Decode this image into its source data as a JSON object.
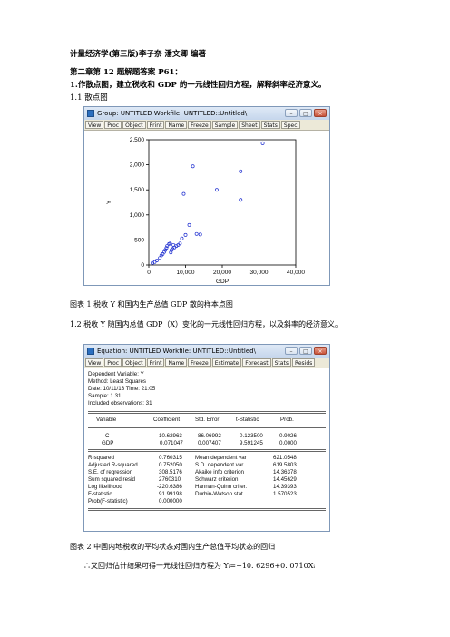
{
  "header": {
    "line1": "计量经济学(第三版)李子奈  潘文卿  编著",
    "line2": "第二章第 12 题解题答案 P61：",
    "line3": "1.作散点图，建立税收和 GDP 的一元线性回归方程，解释斜率经济意义。",
    "sec1": "1.1 散点图"
  },
  "scatter_window": {
    "title": "Group: UNTITLED   Workfile: UNTITLED::Untitled\\",
    "buttons": [
      "View",
      "Proc",
      "Object",
      "Print",
      "Name",
      "Freeze",
      "Sample",
      "Sheet",
      "Stats",
      "Spec"
    ],
    "wctrl": [
      "–",
      "□",
      "×"
    ]
  },
  "chart_data": {
    "type": "scatter",
    "xlabel": "GDP",
    "ylabel": "Y",
    "xlim": [
      0,
      40000
    ],
    "ylim": [
      0,
      2500
    ],
    "xticks": [
      "0",
      "10,000",
      "20,000",
      "30,000",
      "40,000"
    ],
    "yticks": [
      "0",
      "500",
      "1,000",
      "1,500",
      "2,000",
      "2,500"
    ],
    "points": [
      [
        1000,
        40
      ],
      [
        1600,
        60
      ],
      [
        2200,
        90
      ],
      [
        3000,
        140
      ],
      [
        3400,
        190
      ],
      [
        3800,
        220
      ],
      [
        4200,
        260
      ],
      [
        4500,
        300
      ],
      [
        4800,
        340
      ],
      [
        5000,
        380
      ],
      [
        5500,
        420
      ],
      [
        5800,
        430
      ],
      [
        6000,
        250
      ],
      [
        6200,
        300
      ],
      [
        6500,
        320
      ],
      [
        6700,
        400
      ],
      [
        7000,
        350
      ],
      [
        7500,
        380
      ],
      [
        8000,
        400
      ],
      [
        8500,
        430
      ],
      [
        9000,
        530
      ],
      [
        9500,
        1420
      ],
      [
        10000,
        600
      ],
      [
        11000,
        800
      ],
      [
        12000,
        1970
      ],
      [
        13000,
        620
      ],
      [
        14000,
        610
      ],
      [
        18500,
        1500
      ],
      [
        25000,
        1870
      ],
      [
        25000,
        1300
      ],
      [
        31000,
        2430
      ]
    ]
  },
  "caption1": "图表  1 税收 Y 和国内生产总值 GDP 散的样本点图",
  "sec2": "1.2 税收 Y 随国内总值 GDP（X）变化的一元线性回归方程，以及斜率的经济意义。",
  "eq_window": {
    "title": "Equation: UNTITLED   Workfile: UNTITLED::Untitled\\",
    "buttons": [
      "View",
      "Proc",
      "Object",
      "Print",
      "Name",
      "Freeze",
      "Estimate",
      "Forecast",
      "Stats",
      "Resids"
    ],
    "wctrl": [
      "–",
      "□",
      "×"
    ],
    "info": [
      "Dependent Variable: Y",
      "Method: Least Squares",
      "Date: 10/11/13   Time: 21:05",
      "Sample: 1 31",
      "Included observations: 31"
    ],
    "coef_header": [
      "Variable",
      "Coefficient",
      "Std. Error",
      "t-Statistic",
      "Prob."
    ],
    "coef_rows": [
      [
        "C",
        "-10.62963",
        "86.06992",
        "-0.123500",
        "0.9026"
      ],
      [
        "GDP",
        "0.071047",
        "0.007407",
        "9.591245",
        "0.0000"
      ]
    ],
    "stats_rows": [
      [
        "R-squared",
        "0.760315",
        "Mean dependent var",
        "621.0548"
      ],
      [
        "Adjusted R-squared",
        "0.752050",
        "S.D. dependent var",
        "619.5803"
      ],
      [
        "S.E. of regression",
        "308.5176",
        "Akaike info criterion",
        "14.36378"
      ],
      [
        "Sum squared resid",
        "2760310",
        "Schwarz criterion",
        "14.45629"
      ],
      [
        "Log likelihood",
        "-220.6386",
        "Hannan-Quinn criter.",
        "14.39393"
      ],
      [
        "F-statistic",
        "91.99198",
        "Durbin-Watson stat",
        "1.570523"
      ],
      [
        "Prob(F-statistic)",
        "0.000000",
        "",
        ""
      ]
    ]
  },
  "caption2": "图表  2 中国内地税收的平均状态对国内生产总值平均状态的回归",
  "conclusion": "∴又回归估计结果可得一元线性回归方程为 Yᵢ=−10. 6296+0. 0710Xᵢ"
}
